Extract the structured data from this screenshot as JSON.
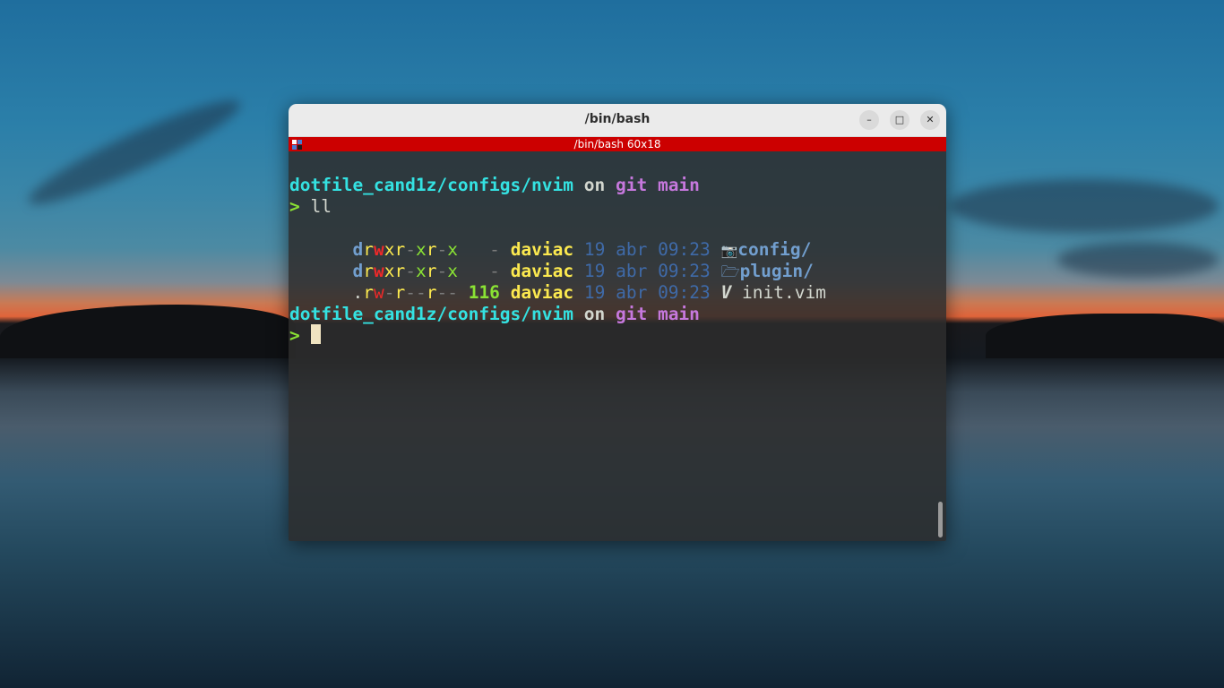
{
  "window": {
    "title": "/bin/bash",
    "minimize_label": "–",
    "maximize_label": "□",
    "close_label": "✕"
  },
  "tab": {
    "title": "/bin/bash 60x18"
  },
  "prompt": {
    "path": "dotfile_cand1z/configs/nvim",
    "on": "on",
    "git": "git",
    "branch": "main",
    "symbol": ">"
  },
  "command": "ll",
  "listing": [
    {
      "perm": [
        "d",
        "r",
        "w",
        "x",
        "r",
        "-",
        "x",
        "r",
        "-",
        "x"
      ],
      "size": "  -",
      "user": "daviac",
      "date": "19 abr 09:23",
      "icon": "folder-config-icon",
      "icon_glyph": "📷",
      "name": "config/",
      "is_dir": true
    },
    {
      "perm": [
        "d",
        "r",
        "w",
        "x",
        "r",
        "-",
        "x",
        "r",
        "-",
        "x"
      ],
      "size": "  -",
      "user": "daviac",
      "date": "19 abr 09:23",
      "icon": "folder-open-icon",
      "icon_glyph": "🗁",
      "name": "plugin/",
      "is_dir": true
    },
    {
      "perm": [
        ".",
        "r",
        "w",
        "-",
        "r",
        "-",
        "-",
        "r",
        "-",
        "-"
      ],
      "size": "116",
      "user": "daviac",
      "date": "19 abr 09:23",
      "icon": "vim-file-icon",
      "icon_glyph": "V",
      "name": "init.vim",
      "is_dir": false
    }
  ],
  "colors": {
    "tabbar": "#cc0000",
    "prompt_path": "#34e2e2",
    "git_branch": "#c678dd",
    "user": "#fce94f",
    "date": "#3f6aa8"
  }
}
